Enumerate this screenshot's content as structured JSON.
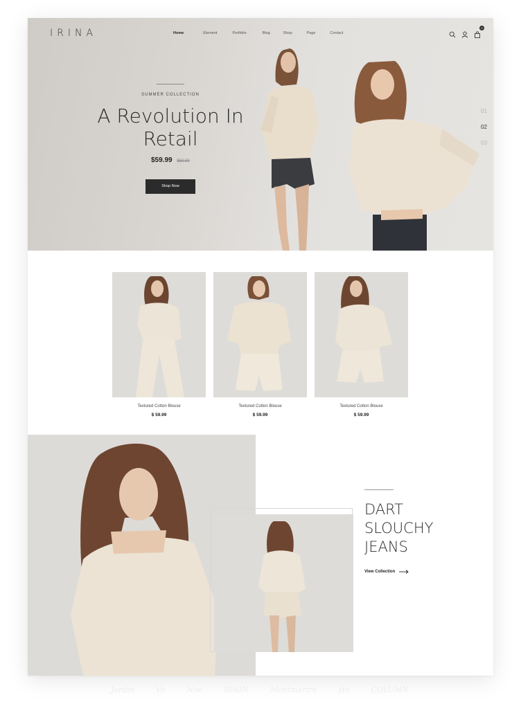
{
  "nav": {
    "logo": "IRINA",
    "items": [
      "Home",
      "Element",
      "Portfolio",
      "Blog",
      "Shop",
      "Page",
      "Contact"
    ],
    "active": "Home",
    "cart_count": "0",
    "icons": [
      "search-icon",
      "user-icon",
      "cart-icon"
    ]
  },
  "hero": {
    "eyebrow": "SUMMER COLLECTION",
    "title_line1": "A Revolution In",
    "title_line2": "Retail",
    "price": "$59.99",
    "old_price": "$59.99",
    "button": "Shop Now",
    "slides": [
      "01",
      "02",
      "03"
    ],
    "active_slide": "02"
  },
  "products": [
    {
      "name": "Textured Cotton Blouse",
      "price": "$ 59.99"
    },
    {
      "name": "Textured Cotton Blouse",
      "price": "$ 59.99"
    },
    {
      "name": "Textured Cotton Blouse",
      "price": "$ 59.99"
    }
  ],
  "feature": {
    "title_line1": "DART",
    "title_line2": "SLOUCHY",
    "title_line3": "JEANS",
    "link": "View Collection"
  },
  "brands": [
    "Jardin",
    "Vo",
    "Noe",
    "SPAIN",
    "Montmartre",
    "Ho",
    "COLUMN"
  ],
  "colors": {
    "accent": "#2b2b2b",
    "hero_bg": "#dcd9d5",
    "cream": "#e8dfd0"
  }
}
